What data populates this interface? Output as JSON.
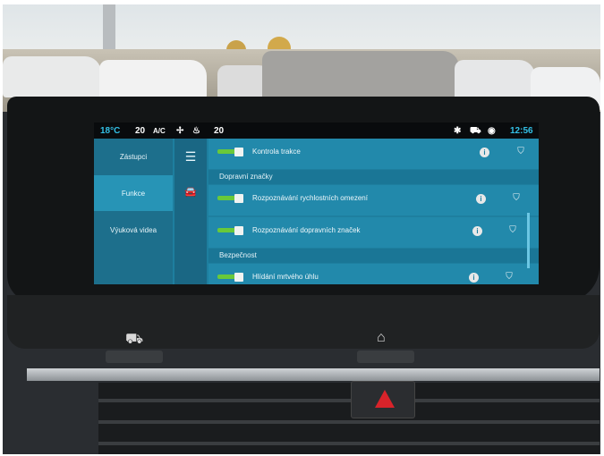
{
  "status_bar": {
    "temp_left": "18°C",
    "fan_level": "20",
    "ac_label": "A/C",
    "temp_right": "20",
    "time": "12:56",
    "accent_color": "#33c0e6"
  },
  "left_menu": {
    "items": [
      {
        "label": "Zástupci",
        "active": false
      },
      {
        "label": "Funkce",
        "active": true
      },
      {
        "label": "Výuková videa",
        "active": false
      }
    ]
  },
  "icon_column": {
    "items": [
      {
        "icon": "hamburger-menu-icon",
        "glyph": "☰"
      },
      {
        "icon": "car-icon",
        "glyph": "🚘"
      }
    ]
  },
  "list": {
    "rows": [
      {
        "type": "setting",
        "label": "Kontrola trakce",
        "enabled": true
      },
      {
        "type": "section",
        "label": "Dopravní značky"
      },
      {
        "type": "setting",
        "label": "Rozpoznávání rychlostních omezení",
        "enabled": true
      },
      {
        "type": "setting",
        "label": "Rozpoznávání dopravních značek",
        "enabled": true
      },
      {
        "type": "section",
        "label": "Bezpečnost"
      },
      {
        "type": "setting",
        "label": "Hlídání mrtvého úhlu",
        "enabled": true
      }
    ],
    "info_glyph": "i",
    "bookmark_glyph": "⛉"
  },
  "hardware": {
    "left_button_icon": "car-icon",
    "home_button_icon": "home-icon",
    "hazard_icon": "hazard-triangle-icon"
  }
}
